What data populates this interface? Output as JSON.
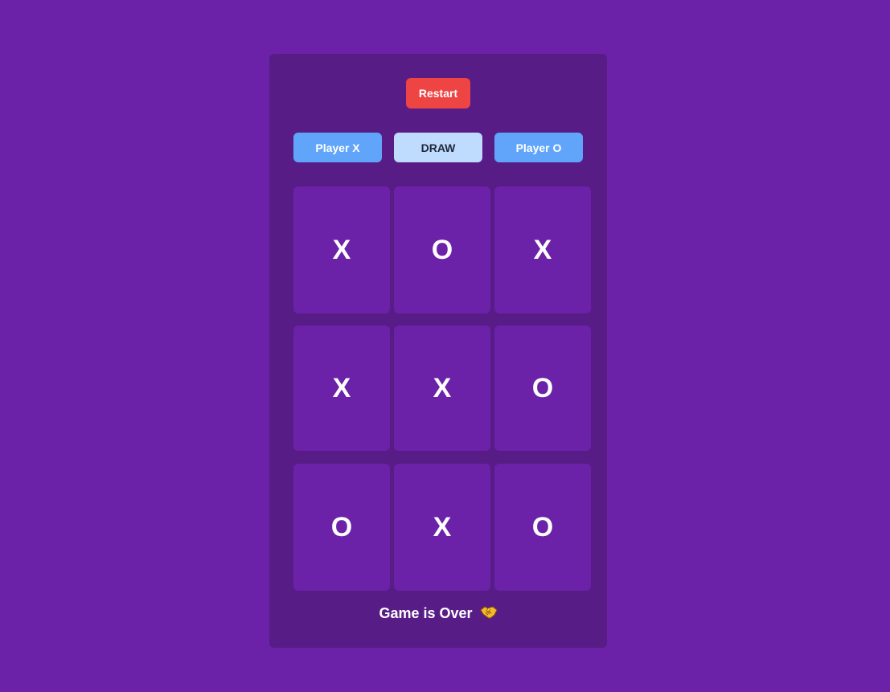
{
  "controls": {
    "restart_label": "Restart"
  },
  "status": {
    "player_x_label": "Player X",
    "draw_label": "DRAW",
    "player_o_label": "Player O"
  },
  "board": {
    "cells": [
      "X",
      "O",
      "X",
      "X",
      "X",
      "O",
      "O",
      "X",
      "O"
    ]
  },
  "message": {
    "text": "Game is Over",
    "icon": "handshake-icon"
  },
  "colors": {
    "background": "#6b21a8",
    "panel": "#581c87",
    "restart": "#ef4444",
    "player_pill": "#60a5fa",
    "draw_pill": "#bfdbfe"
  }
}
